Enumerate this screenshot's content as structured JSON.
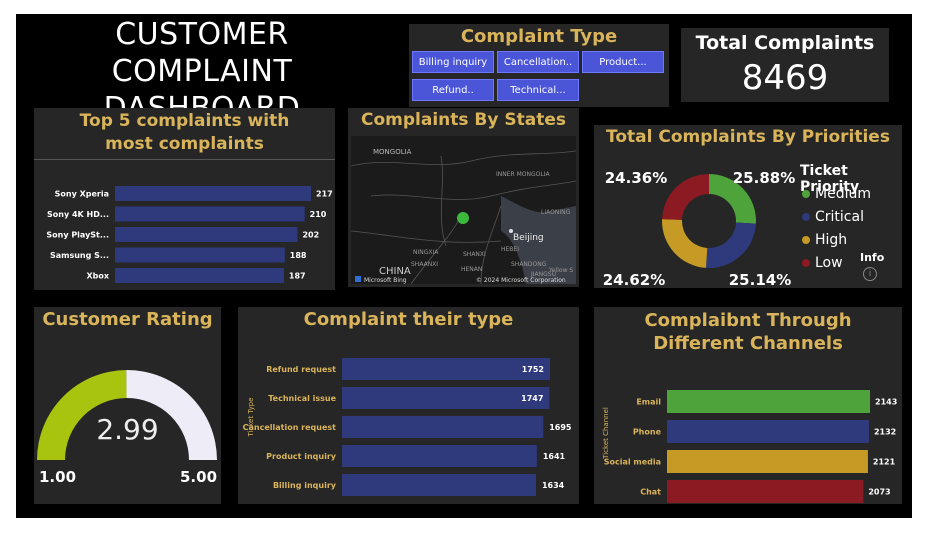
{
  "header": {
    "title": "CUSTOMER COMPLAINT DASHBOARD"
  },
  "slicer": {
    "title": "Complaint Type",
    "buttons": [
      "Billing inquiry",
      "Cancellation..",
      "Product...",
      "Refund..",
      "Technical..."
    ]
  },
  "kpi": {
    "label": "Total Complaints",
    "value": "8469"
  },
  "top5": {
    "title": "Top 5 complaints with most complaints",
    "chart_data": {
      "type": "bar",
      "categories": [
        "Sony Xperia",
        "Sony 4K HD...",
        "Sony PlaySt...",
        "Samsung S...",
        "Xbox"
      ],
      "values": [
        217,
        210,
        202,
        188,
        187
      ],
      "orientation": "horizontal",
      "color": "#2e3a7c"
    }
  },
  "map": {
    "title": "Complaints By States",
    "labels": [
      "MONGOLIA",
      "INNER MONGOLIA",
      "LIAONING",
      "Beijing",
      "NINGXIA",
      "SHANXI",
      "HEBEI",
      "SHANDONG",
      "SHAANXI",
      "HENAN",
      "JIANGSU",
      "CHINA",
      "Yellow S"
    ],
    "credit": "Microsoft Bing",
    "copyright": "© 2024 Microsoft Corporation"
  },
  "priorities": {
    "title": "Total Complaints By Priorities",
    "legend_title": "Ticket Priority",
    "info_label": "Info",
    "chart_data": {
      "type": "pie",
      "labels": [
        "Medium",
        "Critical",
        "High",
        "Low"
      ],
      "values": [
        25.88,
        25.14,
        24.62,
        24.36
      ],
      "value_labels": [
        "25.88%",
        "25.14%",
        "24.62%",
        "24.36%"
      ],
      "colors": [
        "#4fa33b",
        "#2e3a7c",
        "#c59b25",
        "#8b1a22"
      ]
    }
  },
  "rating": {
    "title": "Customer Rating",
    "value": "2.99",
    "min": "1.00",
    "max": "5.00",
    "chart_data": {
      "type": "gauge",
      "value": 2.99,
      "min": 1.0,
      "max": 5.0,
      "fill": "#a8c40e",
      "track": "#eeecf6"
    }
  },
  "types": {
    "title": "Complaint their type",
    "axis_label": "Ticket Type",
    "chart_data": {
      "type": "bar",
      "categories": [
        "Refund request",
        "Technical issue",
        "Cancellation request",
        "Product inquiry",
        "Billing inquiry"
      ],
      "values": [
        1752,
        1747,
        1695,
        1641,
        1634
      ],
      "orientation": "horizontal",
      "color": "#2e3a7c"
    }
  },
  "channels": {
    "title": "Complaibnt Through Different Channels",
    "axis_label": "Ticket Channel",
    "chart_data": {
      "type": "bar",
      "categories": [
        "Email",
        "Phone",
        "Social media",
        "Chat"
      ],
      "values": [
        2143,
        2132,
        2121,
        2073
      ],
      "orientation": "horizontal",
      "colors": [
        "#4fa33b",
        "#2e3a7c",
        "#c59b25",
        "#8b1a22"
      ]
    }
  }
}
